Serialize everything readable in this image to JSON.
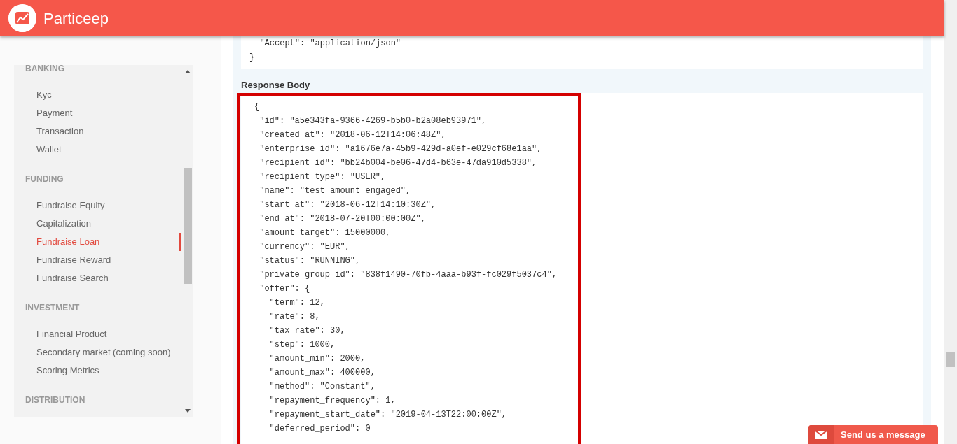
{
  "header": {
    "brand": "Particeep"
  },
  "sidebar": {
    "sections": [
      {
        "heading": "BANKING",
        "items": [
          {
            "label": "Kyc",
            "selected": false
          },
          {
            "label": "Payment",
            "selected": false
          },
          {
            "label": "Transaction",
            "selected": false
          },
          {
            "label": "Wallet",
            "selected": false
          }
        ]
      },
      {
        "heading": "FUNDING",
        "items": [
          {
            "label": "Fundraise Equity",
            "selected": false
          },
          {
            "label": "Capitalization",
            "selected": false
          },
          {
            "label": "Fundraise Loan",
            "selected": true
          },
          {
            "label": "Fundraise Reward",
            "selected": false
          },
          {
            "label": "Fundraise Search",
            "selected": false
          }
        ]
      },
      {
        "heading": "INVESTMENT",
        "items": [
          {
            "label": "Financial Product",
            "selected": false
          },
          {
            "label": "Secondary market (coming soon)",
            "selected": false
          },
          {
            "label": "Scoring Metrics",
            "selected": false
          }
        ]
      },
      {
        "heading": "DISTRIBUTION"
      }
    ]
  },
  "request_headers": {
    "lines": [
      "  \"Accept\": \"application/json\"",
      "}"
    ]
  },
  "response_body": {
    "title": "Response Body",
    "highlighted": true,
    "lines": [
      "{",
      " \"id\": \"a5e343fa-9366-4269-b5b0-b2a08eb93971\",",
      " \"created_at\": \"2018-06-12T14:06:48Z\",",
      " \"enterprise_id\": \"a1676e7a-45b9-429d-a0ef-e029cf68e1aa\",",
      " \"recipient_id\": \"bb24b004-be06-47d4-b63e-47da910d5338\",",
      " \"recipient_type\": \"USER\",",
      " \"name\": \"test amount engaged\",",
      " \"start_at\": \"2018-06-12T14:10:30Z\",",
      " \"end_at\": \"2018-07-20T00:00:00Z\",",
      " \"amount_target\": 15000000,",
      " \"currency\": \"EUR\",",
      " \"status\": \"RUNNING\",",
      " \"private_group_id\": \"838f1490-70fb-4aaa-b93f-fc029f5037c4\",",
      " \"offer\": {",
      "   \"term\": 12,",
      "   \"rate\": 8,",
      "   \"tax_rate\": 30,",
      "   \"step\": 1000,",
      "   \"amount_min\": 2000,",
      "   \"amount_max\": 400000,",
      "   \"method\": \"Constant\",",
      "   \"repayment_frequency\": 1,",
      "   \"repayment_start_date\": \"2019-04-13T22:00:00Z\",",
      "   \"deferred_period\": 0"
    ]
  },
  "chat_button": {
    "label": "Send us a message"
  }
}
